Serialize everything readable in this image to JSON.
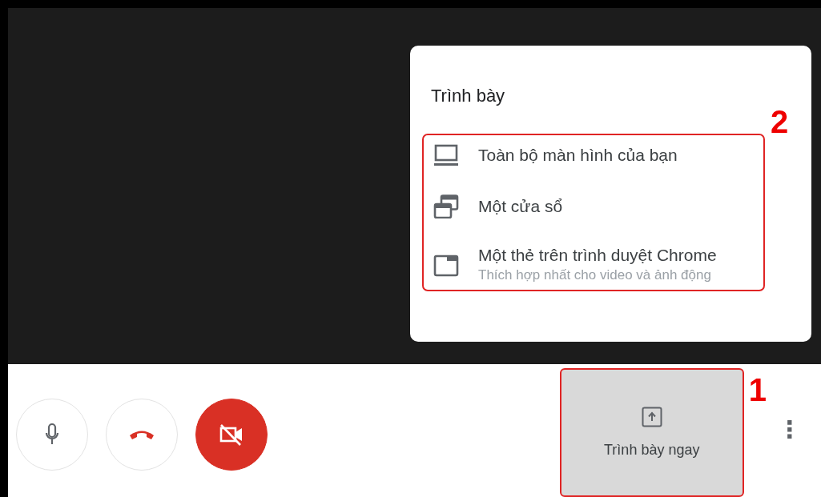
{
  "present_menu": {
    "title": "Trình bày",
    "annotation": "2",
    "options": [
      {
        "kind": "screen",
        "label": "Toàn bộ màn hình của bạn"
      },
      {
        "kind": "window",
        "label": "Một cửa sổ"
      },
      {
        "kind": "tab",
        "label": "Một thẻ trên trình duyệt Chrome",
        "subtitle": "Thích hợp nhất cho video và ảnh động"
      }
    ]
  },
  "call_controls": [
    {
      "kind": "mic",
      "muted": false
    },
    {
      "kind": "hangup"
    },
    {
      "kind": "camera",
      "muted": true
    }
  ],
  "present_button": {
    "label": "Trình bày ngay",
    "annotation": "1"
  },
  "more_button": {
    "label": "⋮"
  }
}
